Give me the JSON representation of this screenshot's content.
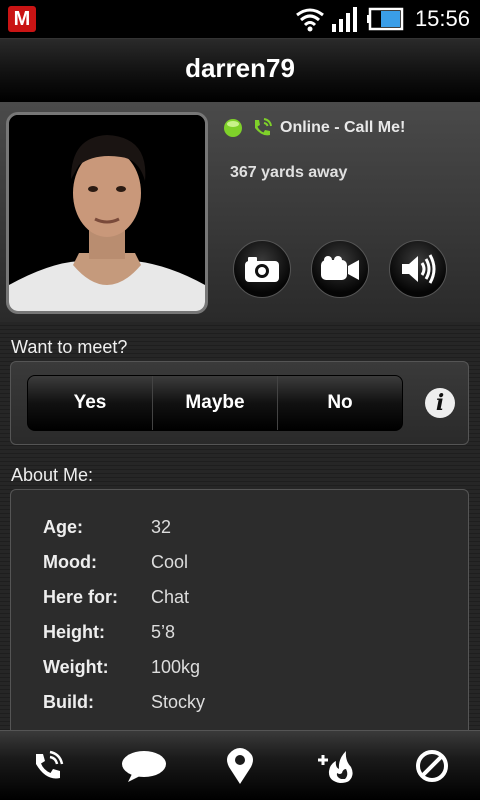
{
  "status_bar": {
    "app_icon_letter": "M",
    "time": "15:56",
    "icons": [
      "wifi-icon",
      "signal-icon",
      "battery-icon"
    ]
  },
  "header": {
    "title": "darren79"
  },
  "profile": {
    "status_text": "Online - Call Me!",
    "distance": "367 yards away",
    "status_icons": [
      "online-dot-icon",
      "phone-ringing-icon"
    ],
    "media_buttons": [
      "camera-icon",
      "video-camera-icon",
      "speaker-icon"
    ]
  },
  "meet": {
    "label": "Want to meet?",
    "options": [
      "Yes",
      "Maybe",
      "No"
    ],
    "info_glyph": "i"
  },
  "about": {
    "label": "About Me:",
    "rows": [
      {
        "key": "Age:",
        "value": "32"
      },
      {
        "key": "Mood:",
        "value": "Cool"
      },
      {
        "key": "Here for:",
        "value": "Chat"
      },
      {
        "key": "Height:",
        "value": "5’8"
      },
      {
        "key": "Weight:",
        "value": "100kg"
      },
      {
        "key": "Build:",
        "value": "Stocky"
      }
    ]
  },
  "bottom_nav": [
    "call-icon",
    "chat-bubble-icon",
    "location-pin-icon",
    "add-favorite-flame-icon",
    "block-icon"
  ],
  "colors": {
    "online_green": "#7fd12a",
    "accent_red": "#c91414"
  }
}
